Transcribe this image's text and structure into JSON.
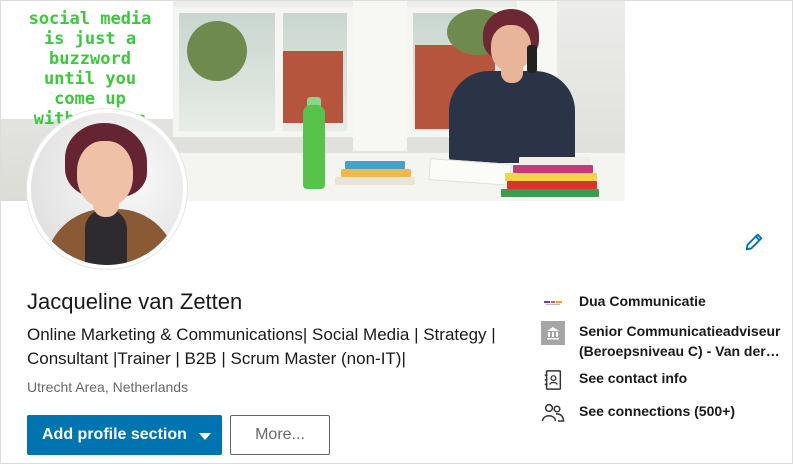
{
  "banner": {
    "quote_text": "social media\nis just a\nbuzzword\nuntil you\ncome up\nwith a plan"
  },
  "profile": {
    "name": "Jacqueline van Zetten",
    "headline": "Online Marketing & Communications| Social Media | Strategy | Consultant |Trainer | B2B | Scrum Master (non-IT)|",
    "location": "Utrecht Area, Netherlands"
  },
  "actions": {
    "add_profile_section": "Add profile section",
    "more": "More..."
  },
  "sidebar": {
    "company": "Dua Communicatie",
    "school_line1": "Senior Communicatieadviseur",
    "school_line2": "(Beroepsniveau C) - Van der…",
    "contact_info": "See contact info",
    "connections": "See connections (500+)"
  },
  "colors": {
    "primary": "#0073b1",
    "quote_green": "#3cc83c"
  },
  "icons": {
    "edit": "pencil-icon",
    "company": "dua-logo-icon",
    "school": "school-building-icon",
    "contact": "contact-card-icon",
    "connections": "people-icon",
    "dropdown": "caret-down-icon"
  }
}
